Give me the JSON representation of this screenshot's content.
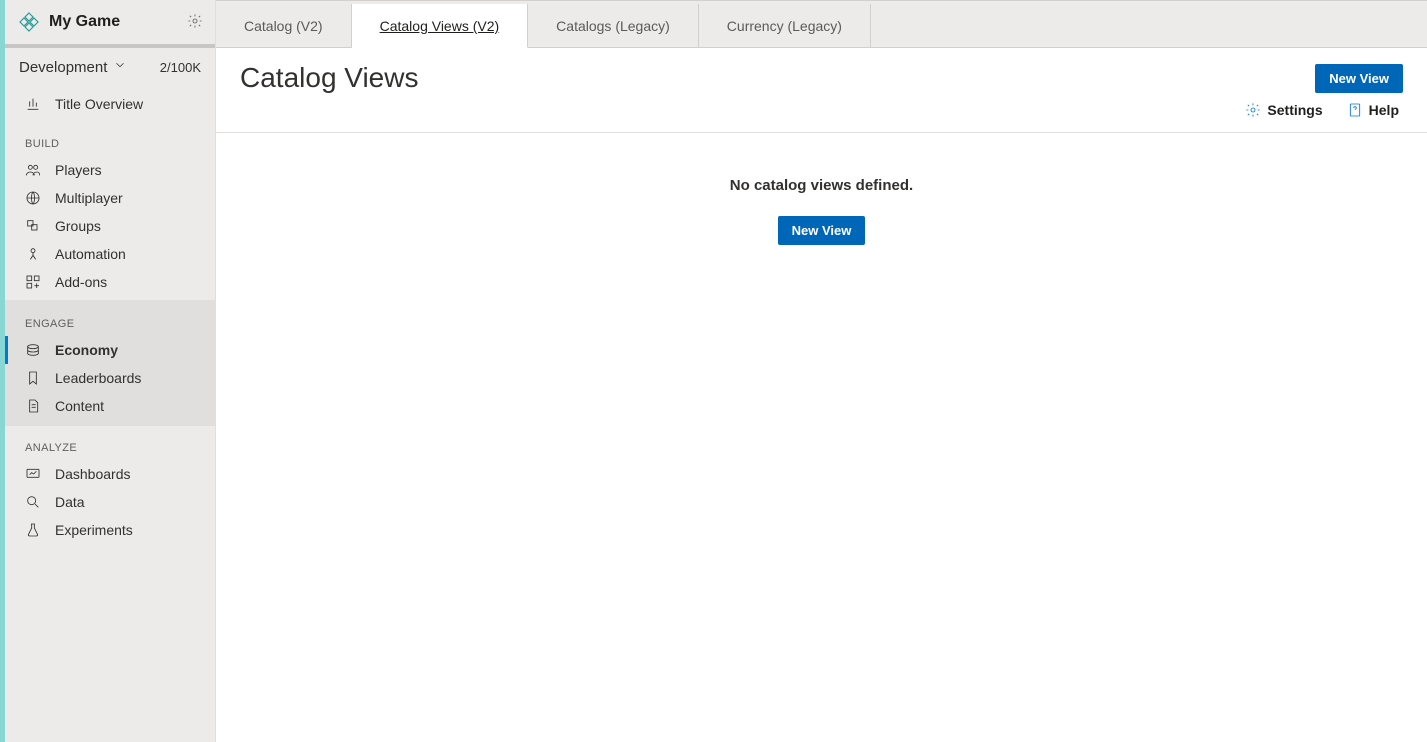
{
  "sidebar": {
    "game_name": "My Game",
    "environment": "Development",
    "usage": "2/100K",
    "title_overview": "Title Overview",
    "sections": {
      "build": {
        "label": "BUILD",
        "items": [
          "Players",
          "Multiplayer",
          "Groups",
          "Automation",
          "Add-ons"
        ]
      },
      "engage": {
        "label": "ENGAGE",
        "items": [
          "Economy",
          "Leaderboards",
          "Content"
        ]
      },
      "analyze": {
        "label": "ANALYZE",
        "items": [
          "Dashboards",
          "Data",
          "Experiments"
        ]
      }
    }
  },
  "tabs": {
    "items": [
      "Catalog (V2)",
      "Catalog Views (V2)",
      "Catalogs (Legacy)",
      "Currency (Legacy)"
    ]
  },
  "header": {
    "page_title": "Catalog Views",
    "new_view": "New View",
    "settings": "Settings",
    "help": "Help"
  },
  "empty": {
    "message": "No catalog views defined.",
    "button": "New View"
  }
}
